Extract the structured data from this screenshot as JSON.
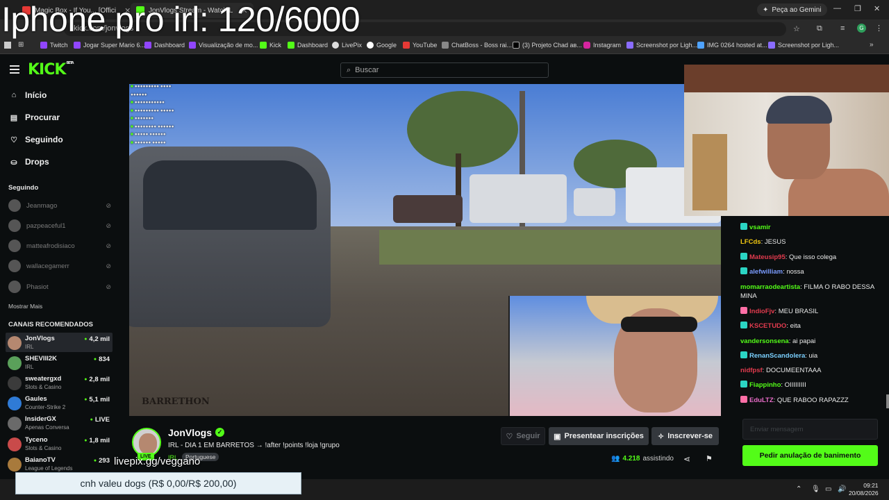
{
  "overlay_title": "Iphone pro irl: 120/6000",
  "browser": {
    "tabs": [
      {
        "label": "Magic Box - If You... [Offici",
        "color": "#e53935"
      },
      {
        "label": "JonVlogs Stream - Watch L",
        "color": "#53fc18"
      }
    ],
    "gemini_label": "Peça ao Gemini",
    "url": "kick.com/jonvlogs",
    "bookmarks": [
      "Twitch",
      "Jogar Super Mario 6...",
      "Dashboard",
      "Visualização de mo...",
      "Kick",
      "Dashboard",
      "LivePix",
      "Google",
      "YouTube",
      "ChatBoss - Boss rai...",
      "(3) Projeto Chad ав...",
      "Instagram",
      "Screenshot por Ligh...",
      "IMG 0264 hosted at...",
      "Screenshot por Ligh..."
    ]
  },
  "header": {
    "logo": "KICK",
    "logo_tag": "BETA",
    "search_placeholder": "Buscar"
  },
  "sidebar": {
    "nav": [
      {
        "label": "Início",
        "icon": "home-icon"
      },
      {
        "label": "Procurar",
        "icon": "browse-icon"
      },
      {
        "label": "Seguindo",
        "icon": "heart-icon"
      },
      {
        "label": "Drops",
        "icon": "drops-icon"
      }
    ],
    "following_title": "Seguindo",
    "following": [
      "Jeanmago",
      "pazpeaceful1",
      "matteafrodisiaco",
      "wallacegamerr",
      "Phasiot"
    ],
    "show_more": "Mostrar Mais",
    "recommended_title": "CANAIS RECOMENDADOS",
    "recommended": [
      {
        "name": "JonVlogs",
        "category": "IRL",
        "viewers": "4,2 mil"
      },
      {
        "name": "SHEVIII2K",
        "category": "IRL",
        "viewers": "834"
      },
      {
        "name": "sweatergxd",
        "category": "Slots & Casino",
        "viewers": "2,8 mil"
      },
      {
        "name": "Gaules",
        "category": "Counter-Strike 2",
        "viewers": "5,1 mil"
      },
      {
        "name": "InsiderGX",
        "category": "Apenas Conversa",
        "viewers": "LIVE"
      },
      {
        "name": "Tyceno",
        "category": "Slots & Casino",
        "viewers": "1,8 mil"
      },
      {
        "name": "BaianoTV",
        "category": "League of Legends",
        "viewers": "293"
      }
    ]
  },
  "player": {
    "watermark": "BARRETHON"
  },
  "channel": {
    "name": "JonVlogs",
    "live": "LIVE",
    "title": "IRL - DIA 1 EM BARRETOS → !after !points !loja !grupo",
    "category": "IRL",
    "language": "Portuguese",
    "follow_label": "Seguir",
    "gift_label": "Presentear inscrições",
    "subscribe_label": "Inscrever-se",
    "viewers_count": "4.218",
    "viewers_suffix": "assistindo"
  },
  "chat": {
    "messages": [
      {
        "user": "vsamir",
        "text": "",
        "color": "#53fc18",
        "badge": "#2bd5c4"
      },
      {
        "user": "LFCds",
        "text": ": JESUS",
        "color": "#f2c811",
        "badge": ""
      },
      {
        "user": "Mateusip95",
        "text": ": Que isso colega",
        "color": "#e23b4e",
        "badge": "#2bd5c4"
      },
      {
        "user": "alefwilliam",
        "text": ": nossa",
        "color": "#7b9cff",
        "badge": "#2bd5c4"
      },
      {
        "user": "momarraodeartista",
        "text": ": FILMA O RABO DESSA MINA",
        "color": "#53fc18",
        "badge": ""
      },
      {
        "user": "IndioFjv",
        "text": ": MEU BRASIL",
        "color": "#e23b4e",
        "badge": "#ff6fa6"
      },
      {
        "user": "KSCETUDO",
        "text": ": eita",
        "color": "#e23b4e",
        "badge": "#2bd5c4"
      },
      {
        "user": "vandersonsena",
        "text": ": ai papai",
        "color": "#53fc18",
        "badge": ""
      },
      {
        "user": "RenanScandolera",
        "text": ": uia",
        "color": "#7bd0ff",
        "badge": "#2bd5c4"
      },
      {
        "user": "nidfpsf",
        "text": ": DOCUMEENTAAA",
        "color": "#e23b4e",
        "badge": ""
      },
      {
        "user": "Fiappinho",
        "text": ": OIIIIIIIII",
        "color": "#53fc18",
        "badge": "#2bd5c4"
      },
      {
        "user": "EduLTZ",
        "text": ": QUE RABOO RAPAZZZ",
        "color": "#e86cc8",
        "badge": "#ff6fa6"
      }
    ],
    "input_placeholder": "Enviar mensagem",
    "ban_button": "Pedir anulação de banimento"
  },
  "overlays": {
    "livepix": "livepix.gg/veggano",
    "goal": "cnh valeu dogs (R$ 0,00/R$ 200,00)"
  },
  "taskbar": {
    "time": "09:21",
    "date": "20/08/2026"
  },
  "colors": {
    "accent": "#53fc18",
    "background": "#0b0e0f"
  }
}
